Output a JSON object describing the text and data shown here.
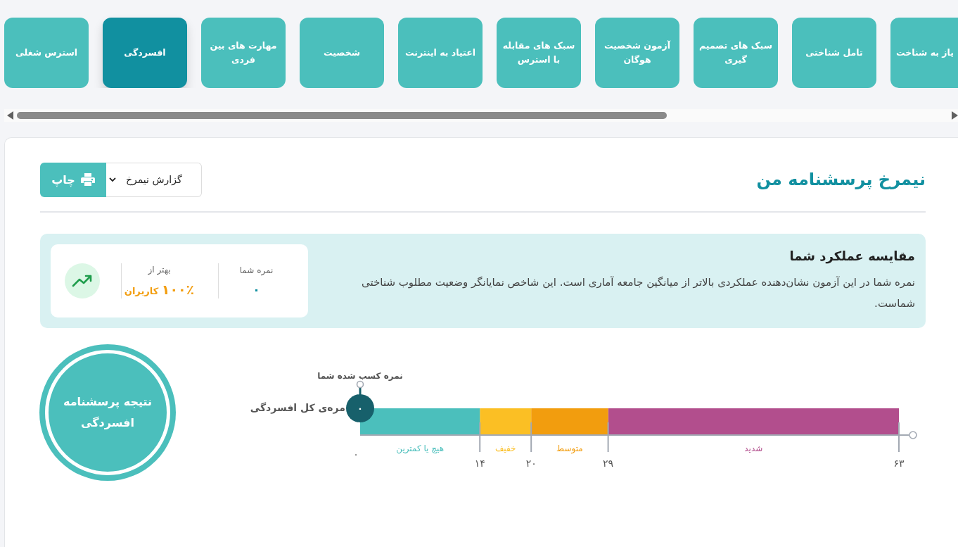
{
  "tabs": [
    {
      "label": "یاز به شناخت",
      "selected": false
    },
    {
      "label": "تامل شناختی",
      "selected": false
    },
    {
      "label": "سبک های تصمیم گیری",
      "selected": false
    },
    {
      "label": "آزمون شخصیت هوگان",
      "selected": false
    },
    {
      "label": "سبک های مقابله با استرس",
      "selected": false
    },
    {
      "label": "اعتیاد به اینترنت",
      "selected": false
    },
    {
      "label": "شخصیت",
      "selected": false
    },
    {
      "label": "مهارت های بین فردی",
      "selected": false
    },
    {
      "label": "افسردگی",
      "selected": true
    },
    {
      "label": "استرس شغلی",
      "selected": false
    }
  ],
  "header": {
    "title": "نیمرخ پرسشنامه من",
    "report_select": "گزارش نیمرخ",
    "print_button": "چاپ"
  },
  "comparison": {
    "title": "مقایسه عملکرد شما",
    "description": "نمره شما در این آزمون نشان‌دهنده عملکردی بالاتر از میانگین جامعه آماری است. این شاخص نمایانگر وضعیت مطلوب شناختی شماست.",
    "score": {
      "label": "نمره شما",
      "value": "۰"
    },
    "better_than": {
      "label": "بهتر از",
      "value": "۱۰۰٪",
      "unit": "کاربران"
    }
  },
  "result": {
    "title": "نتیجه پرسشنامه افسردگی",
    "scale": {
      "label": "مره‌ی کل افسردگی",
      "marker": {
        "caption": "نمره کسب شده شما",
        "value": "۰"
      },
      "ticks": [
        "۶۳",
        "۲۹",
        "۲۰",
        "۱۴",
        "۰"
      ],
      "segments": [
        {
          "label": "شدید",
          "color": "#b24e8d"
        },
        {
          "label": "متوسط",
          "color": "#f29d0e"
        },
        {
          "label": "خفیف",
          "color": "#fbbf24"
        },
        {
          "label": "هیچ یا کمترین",
          "color": "#4bbfbc"
        }
      ]
    }
  }
}
